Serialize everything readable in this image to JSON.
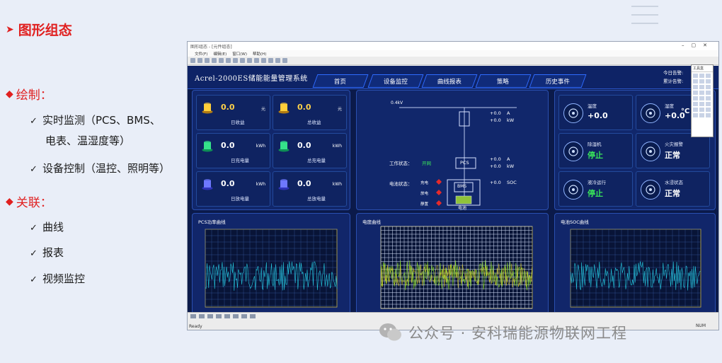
{
  "slide": {
    "title": "图形组态",
    "sections": [
      {
        "label": "绘制：",
        "items": [
          "实时监测（PCS、BMS、",
          "电表、温湿度等）",
          "设备控制（温控、照明等）"
        ]
      },
      {
        "label": "关联：",
        "items": [
          "曲线",
          "报表",
          "视频监控"
        ]
      }
    ],
    "watermark": "公众号 · 安科瑞能源物联网工程"
  },
  "window": {
    "title": "图形组态 - [元件组态]",
    "menus": [
      "文件(F)",
      "编辑(E)",
      "窗口(W)",
      "帮助(H)"
    ],
    "status_ready": "Ready",
    "status_num": "NUM"
  },
  "scada": {
    "system_title": "Acrel-2000ES储能能量管理系统",
    "nav": [
      "首页",
      "设备监控",
      "曲线报表",
      "策略",
      "历史事件"
    ],
    "alarm_today": "今日告警:",
    "alarm_total": "累计告警:",
    "stats": [
      {
        "value": "0.0",
        "unit": "元",
        "label": "日收益",
        "color": "gold"
      },
      {
        "value": "0.0",
        "unit": "元",
        "label": "总收益",
        "color": "gold"
      },
      {
        "value": "0.0",
        "unit": "kWh",
        "label": "日充电量",
        "color": "green"
      },
      {
        "value": "0.0",
        "unit": "kWh",
        "label": "总充电量",
        "color": "green"
      },
      {
        "value": "0.0",
        "unit": "kWh",
        "label": "日放电量",
        "color": "purple"
      },
      {
        "value": "0.0",
        "unit": "kWh",
        "label": "总放电量",
        "color": "purple"
      }
    ],
    "diagram": {
      "voltage": "0.4kV",
      "meter": [
        {
          "value": "+0.0",
          "unit": "A"
        },
        {
          "value": "+0.0",
          "unit": "kW"
        }
      ],
      "pcs_label": "PCS",
      "pcs": [
        {
          "value": "+0.0",
          "unit": "A"
        },
        {
          "value": "+0.0",
          "unit": "kW"
        }
      ],
      "work_status_label": "工作状态：",
      "work_status_value": "开网",
      "battery_status_label": "电池状态：",
      "battery_states": [
        "充电",
        "放电",
        "静置"
      ],
      "bms_label": "BMS",
      "battery_label": "电池",
      "soc_value": "+0.0",
      "soc_unit": "SOC"
    },
    "env": [
      {
        "name": "温度",
        "value": "+0.0",
        "color": "#ffffff"
      },
      {
        "name": "湿度",
        "value": "+0.0",
        "color": "#ffffff"
      },
      {
        "name": "除湿机",
        "value": "停止",
        "color": "#39e45a"
      },
      {
        "name": "火灾报警",
        "value": "正常",
        "color": "#ffffff"
      },
      {
        "name": "液冷运行",
        "value": "停止",
        "color": "#39e45a"
      },
      {
        "name": "水浸状态",
        "value": "正常",
        "color": "#ffffff"
      }
    ],
    "env_unit": "°C",
    "charts": [
      {
        "title": "PCS功率曲线",
        "color": "#25c9e0"
      },
      {
        "title": "电度曲线",
        "color": "#8cdc2a"
      },
      {
        "title": "电池SOC曲线",
        "color": "#25c9e0"
      }
    ]
  },
  "toolbox": {
    "title": "工具盒"
  }
}
